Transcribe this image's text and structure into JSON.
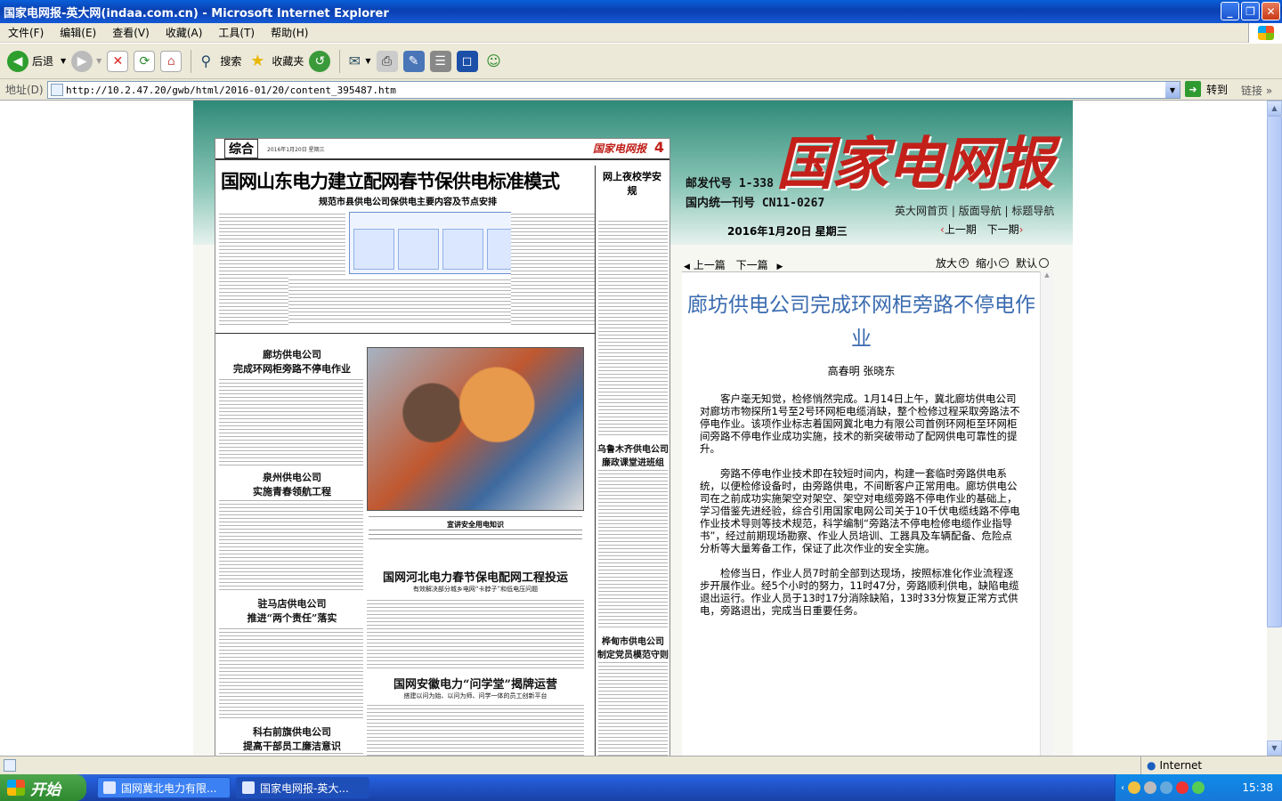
{
  "window": {
    "title": "国家电网报-英大网(indaa.com.cn) - Microsoft Internet Explorer",
    "min": "_",
    "max": "❐",
    "close": "✕"
  },
  "menu": [
    "文件(F)",
    "编辑(E)",
    "查看(V)",
    "收藏(A)",
    "工具(T)",
    "帮助(H)"
  ],
  "toolbar": {
    "back": "后退",
    "search": "搜索",
    "favorites": "收藏夹"
  },
  "address": {
    "label": "地址(D)",
    "url": "http://10.2.47.20/gwb/html/2016-01/20/content_395487.htm",
    "go": "转到",
    "links": "链接"
  },
  "site": {
    "logo": "国家电网报",
    "postal_code": "邮发代号 1-338",
    "issn": "国内统一刊号 CN11-0267",
    "nav": [
      "英大网首页",
      "版面导航",
      "标题导航"
    ],
    "date": "2016年1月20日 星期三",
    "prev_issue": "上一期",
    "next_issue": "下一期",
    "prev_article": "上一篇",
    "next_article": "下一篇",
    "zoom_in": "放大",
    "zoom_out": "缩小",
    "default": "默认"
  },
  "paper": {
    "section": "综合",
    "page_num": "4",
    "name": "国家电网报",
    "date_small": "2016年1月20日 星期三",
    "headline": "国网山东电力建立配网春节保供电标准模式",
    "subhead": "规范市县供电公司保供电主要内容及节点安排",
    "side_box": "网上夜校学安规",
    "articles": [
      {
        "t": "廊坊供电公司",
        "s": "完成环网柜旁路不停电作业"
      },
      {
        "t": "泉州供电公司",
        "s": "实施青春领航工程"
      },
      {
        "t": "驻马店供电公司",
        "s": "推进“两个责任”落实"
      },
      {
        "t": "科右前旗供电公司",
        "s": "提高干部员工廉洁意识"
      },
      {
        "t": "国网河北电力春节保电配网工程投运",
        "s": "有效解决部分城乡电网“卡脖子”和低电压问题"
      },
      {
        "t": "国网安徽电力“问学堂”揭牌运营",
        "s": "搭建以问为始、以问为师、问学一体的员工创新平台"
      },
      {
        "t": "乌鲁木齐供电公司",
        "s": "廉政课堂进班组"
      },
      {
        "t": "桦甸市供电公司",
        "s": "制定党员模范守则"
      }
    ],
    "photo_caption": "宣讲安全用电知识"
  },
  "article": {
    "title": "廊坊供电公司完成环网柜旁路不停电作业",
    "author": "高春明 张晓东",
    "paragraphs": [
      "客户毫无知觉，检修悄然完成。1月14日上午，冀北廊坊供电公司对廊坊市物探所1号至2号环网柜电缆消缺，整个检修过程采取旁路法不停电作业。该项作业标志着国网冀北电力有限公司首例环网柜至环网柜间旁路不停电作业成功实施，技术的新突破带动了配网供电可靠性的提升。",
      "旁路不停电作业技术即在较短时间内，构建一套临时旁路供电系统，以便检修设备时，由旁路供电，不间断客户正常用电。廊坊供电公司在之前成功实施架空对架空、架空对电缆旁路不停电作业的基础上，学习借鉴先进经验，综合引用国家电网公司关于10千伏电缆线路不停电作业技术导则等技术规范，科学编制“旁路法不停电检修电缆作业指导书”，经过前期现场勘察、作业人员培训、工器具及车辆配备、危险点分析等大量筹备工作，保证了此次作业的安全实施。",
      "检修当日，作业人员7时前全部到达现场，按照标准化作业流程逐步开展作业。经5个小时的努力，11时47分，旁路顺利供电，缺陷电缆退出运行。作业人员于13时17分消除缺陷，13时33分恢复正常方式供电，旁路退出，完成当日重要任务。"
    ]
  },
  "status": {
    "zone": "Internet"
  },
  "taskbar": {
    "start": "开始",
    "tasks": [
      "国网冀北电力有限...",
      "国家电网报-英大..."
    ],
    "clock": "15:38"
  }
}
